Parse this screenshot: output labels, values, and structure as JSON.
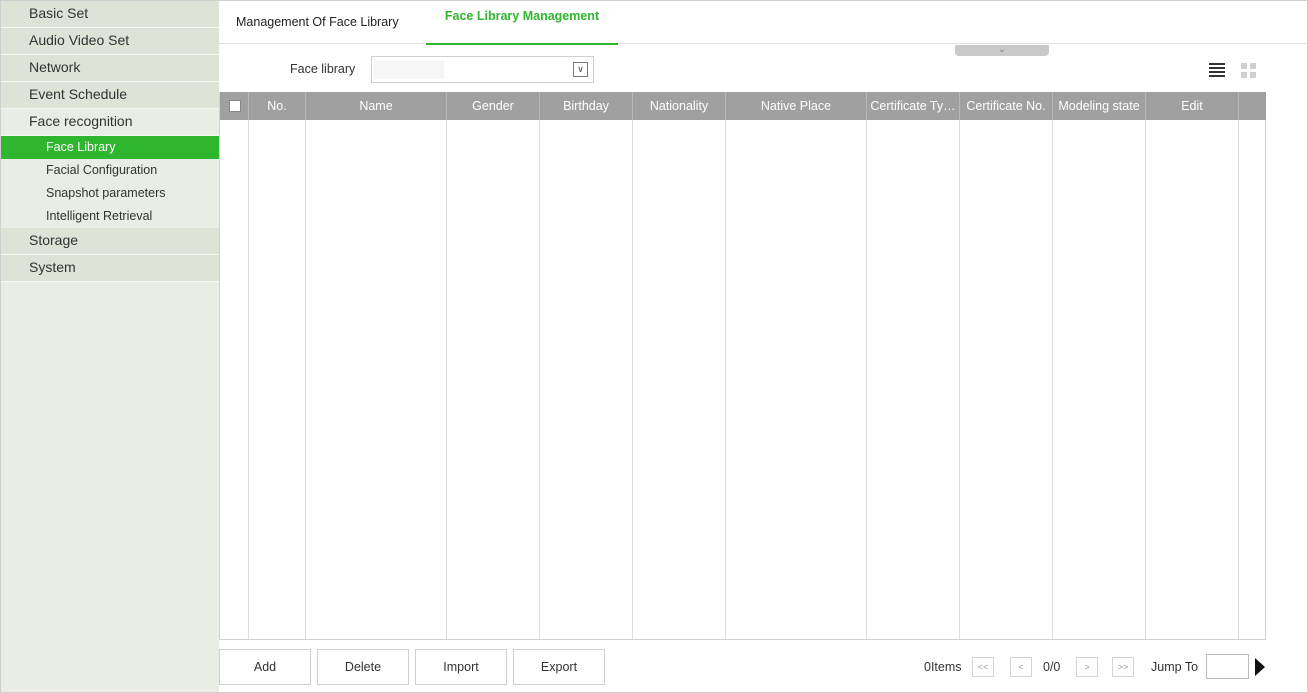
{
  "sidebar": {
    "sections": [
      {
        "label": "Basic Set"
      },
      {
        "label": "Audio Video Set"
      },
      {
        "label": "Network"
      },
      {
        "label": "Event Schedule"
      },
      {
        "label": "Face recognition"
      },
      {
        "label": "Storage"
      },
      {
        "label": "System"
      }
    ],
    "face_items": [
      {
        "label": "Face Library"
      },
      {
        "label": "Facial Configuration"
      },
      {
        "label": "Snapshot parameters"
      },
      {
        "label": "Intelligent Retrieval"
      }
    ]
  },
  "tabs": [
    {
      "label": "Management Of Face Library"
    },
    {
      "label": "Face Library Management"
    }
  ],
  "collapse_handle": "⌄",
  "filter": {
    "label": "Face library",
    "value": "",
    "arrow": "∨"
  },
  "table": {
    "columns": [
      "No.",
      "Name",
      "Gender",
      "Birthday",
      "Nationality",
      "Native Place",
      "Certificate Ty…",
      "Certificate No.",
      "Modeling state",
      "Edit"
    ]
  },
  "actions": {
    "add": "Add",
    "delete": "Delete",
    "import": "Import",
    "export": "Export"
  },
  "pagination": {
    "items": "0Items",
    "first": "<<",
    "prev": "<",
    "page": "0/0",
    "next": ">",
    "last": ">>",
    "jump_label": "Jump To",
    "jump_value": ""
  },
  "colors": {
    "accent": "#2fb62f",
    "header": "#a0a0a0",
    "sidebar": "#e9ede5"
  }
}
